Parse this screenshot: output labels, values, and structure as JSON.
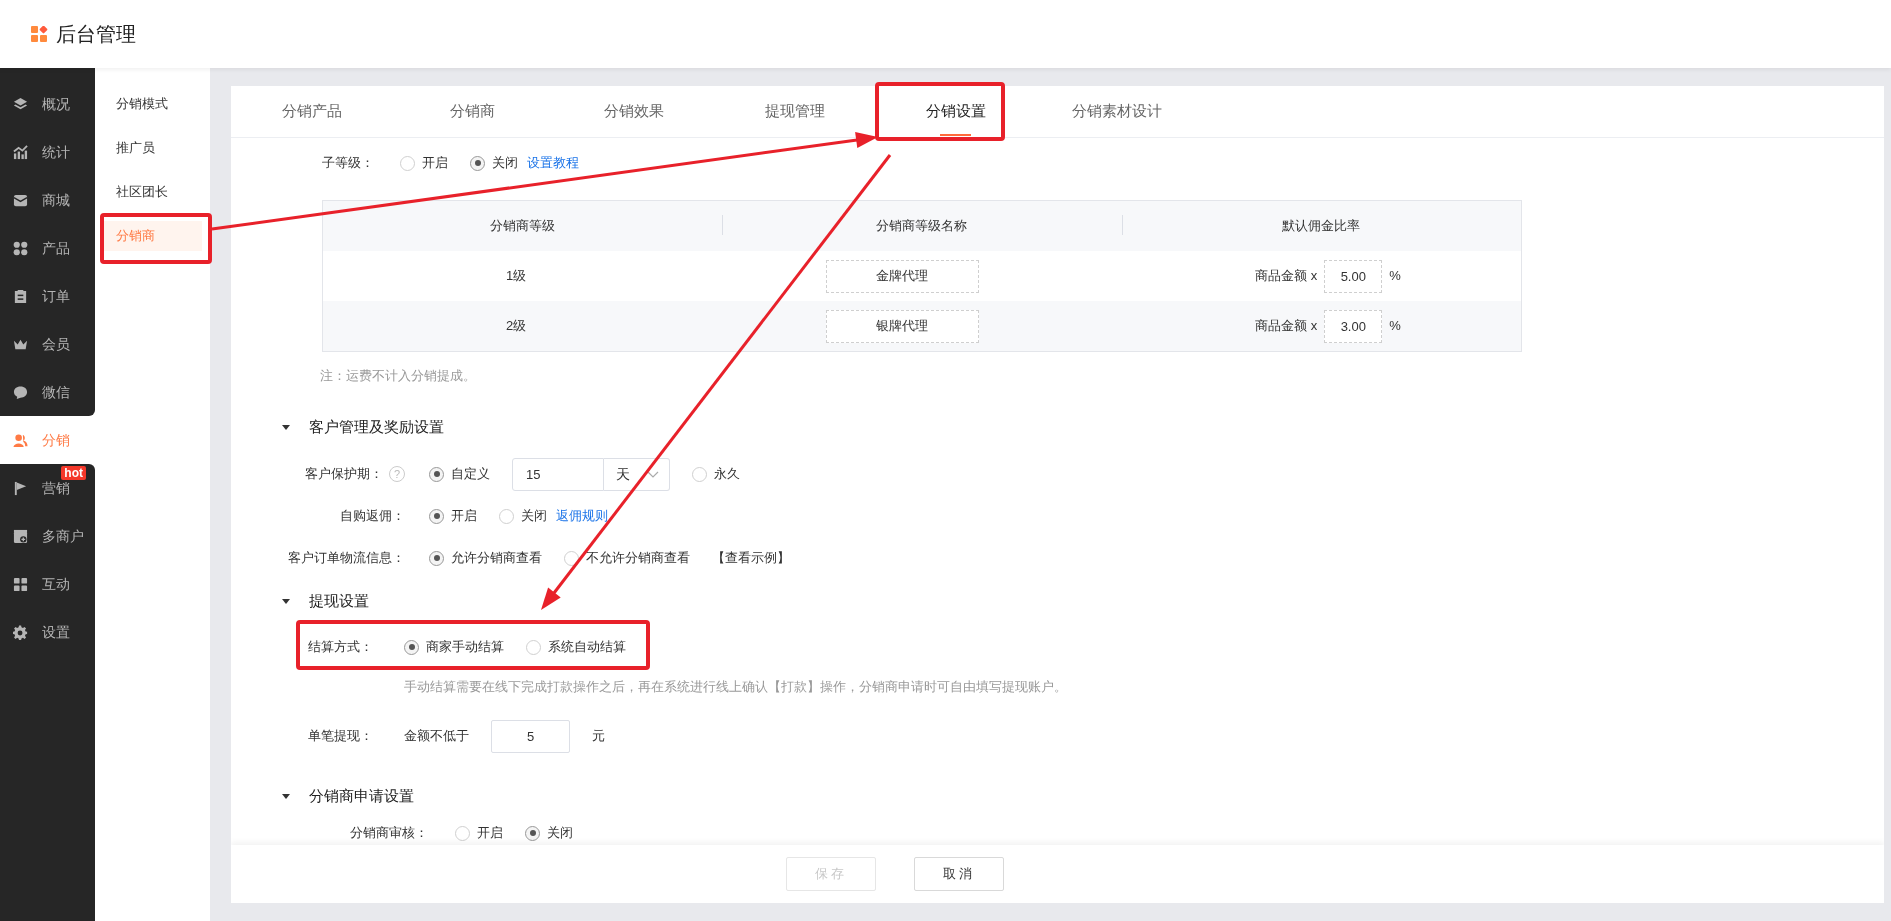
{
  "header": {
    "title": "后台管理"
  },
  "main_menu": [
    {
      "label": "概况",
      "selected": false
    },
    {
      "label": "统计",
      "selected": false
    },
    {
      "label": "商城",
      "selected": false
    },
    {
      "label": "产品",
      "selected": false
    },
    {
      "label": "订单",
      "selected": false
    },
    {
      "label": "会员",
      "selected": false
    },
    {
      "label": "微信",
      "selected": false
    },
    {
      "label": "分销",
      "selected": true
    },
    {
      "label": "营销",
      "selected": false,
      "badge": "hot"
    },
    {
      "label": "多商户",
      "selected": false
    },
    {
      "label": "互动",
      "selected": false
    },
    {
      "label": "设置",
      "selected": false
    }
  ],
  "sub_menu": [
    {
      "label": "分销模式",
      "selected": false
    },
    {
      "label": "推广员",
      "selected": false
    },
    {
      "label": "社区团长",
      "selected": false
    },
    {
      "label": "分销商",
      "selected": true
    }
  ],
  "tabs": [
    {
      "label": "分销产品",
      "selected": false
    },
    {
      "label": "分销商",
      "selected": false
    },
    {
      "label": "分销效果",
      "selected": false
    },
    {
      "label": "提现管理",
      "selected": false
    },
    {
      "label": "分销设置",
      "selected": true
    },
    {
      "label": "分销素材设计",
      "selected": false
    }
  ],
  "sublevel_row": {
    "label": "子等级：",
    "items": [
      {
        "kind": "radio",
        "label": "开启",
        "selected": false
      },
      {
        "kind": "radio",
        "label": "关闭",
        "selected": true
      },
      {
        "kind": "link",
        "label": "设置教程"
      }
    ]
  },
  "level_table": {
    "columns": [
      "分销商等级",
      "分销商等级名称",
      "默认佣金比率"
    ],
    "rows": [
      {
        "level": "1级",
        "name": "金牌代理",
        "rate_prefix": "商品金额 x",
        "rate": "5.00",
        "rate_unit": "%"
      },
      {
        "level": "2级",
        "name": "银牌代理",
        "rate_prefix": "商品金额 x",
        "rate": "3.00",
        "rate_unit": "%"
      }
    ]
  },
  "note": "注：运费不计入分销提成。",
  "sections": [
    {
      "title": "客户管理及奖励设置",
      "expanded": true,
      "rows": [
        {
          "kind": "field",
          "label": "客户保护期：",
          "help": "?",
          "items": [
            {
              "kind": "radio",
              "label": "自定义",
              "selected": true
            },
            {
              "kind": "input",
              "value": "15"
            },
            {
              "kind": "select",
              "value": "天"
            },
            {
              "kind": "radio",
              "label": "永久",
              "selected": false
            }
          ]
        },
        {
          "kind": "field",
          "label": "自购返佣：",
          "items": [
            {
              "kind": "radio",
              "label": "开启",
              "selected": true
            },
            {
              "kind": "radio",
              "label": "关闭",
              "selected": false
            },
            {
              "kind": "link",
              "label": "返佣规则"
            }
          ]
        },
        {
          "kind": "field",
          "label": "客户订单物流信息：",
          "items": [
            {
              "kind": "radio",
              "label": "允许分销商查看",
              "selected": true
            },
            {
              "kind": "radio",
              "label": "不允许分销商查看",
              "selected": false
            },
            {
              "kind": "action",
              "label": "【查看示例】"
            }
          ]
        }
      ]
    },
    {
      "title": "提现设置",
      "expanded": true,
      "rows": [
        {
          "kind": "field",
          "label": "结算方式：",
          "items": [
            {
              "kind": "radio",
              "label": "商家手动结算",
              "selected": true
            },
            {
              "kind": "radio",
              "label": "系统自动结算",
              "selected": false
            }
          ]
        },
        {
          "kind": "hint",
          "text": "手动结算需要在线下完成打款操作之后，再在系统进行线上确认【打款】操作，分销商申请时可自由填写提现账户。"
        },
        {
          "kind": "field",
          "label": "单笔提现：",
          "items": [
            {
              "kind": "text",
              "label": "金额不低于"
            },
            {
              "kind": "input",
              "value": "5"
            },
            {
              "kind": "text",
              "label": "元"
            }
          ]
        }
      ]
    },
    {
      "title": "分销商申请设置",
      "expanded": true,
      "rows": [
        {
          "kind": "field",
          "label": "分销商审核：",
          "items": [
            {
              "kind": "radio",
              "label": "开启",
              "selected": false
            },
            {
              "kind": "radio",
              "label": "关闭",
              "selected": true
            }
          ]
        }
      ]
    }
  ],
  "footer_buttons": [
    {
      "label": "保存",
      "disabled": true
    },
    {
      "label": "取消",
      "disabled": false
    }
  ]
}
